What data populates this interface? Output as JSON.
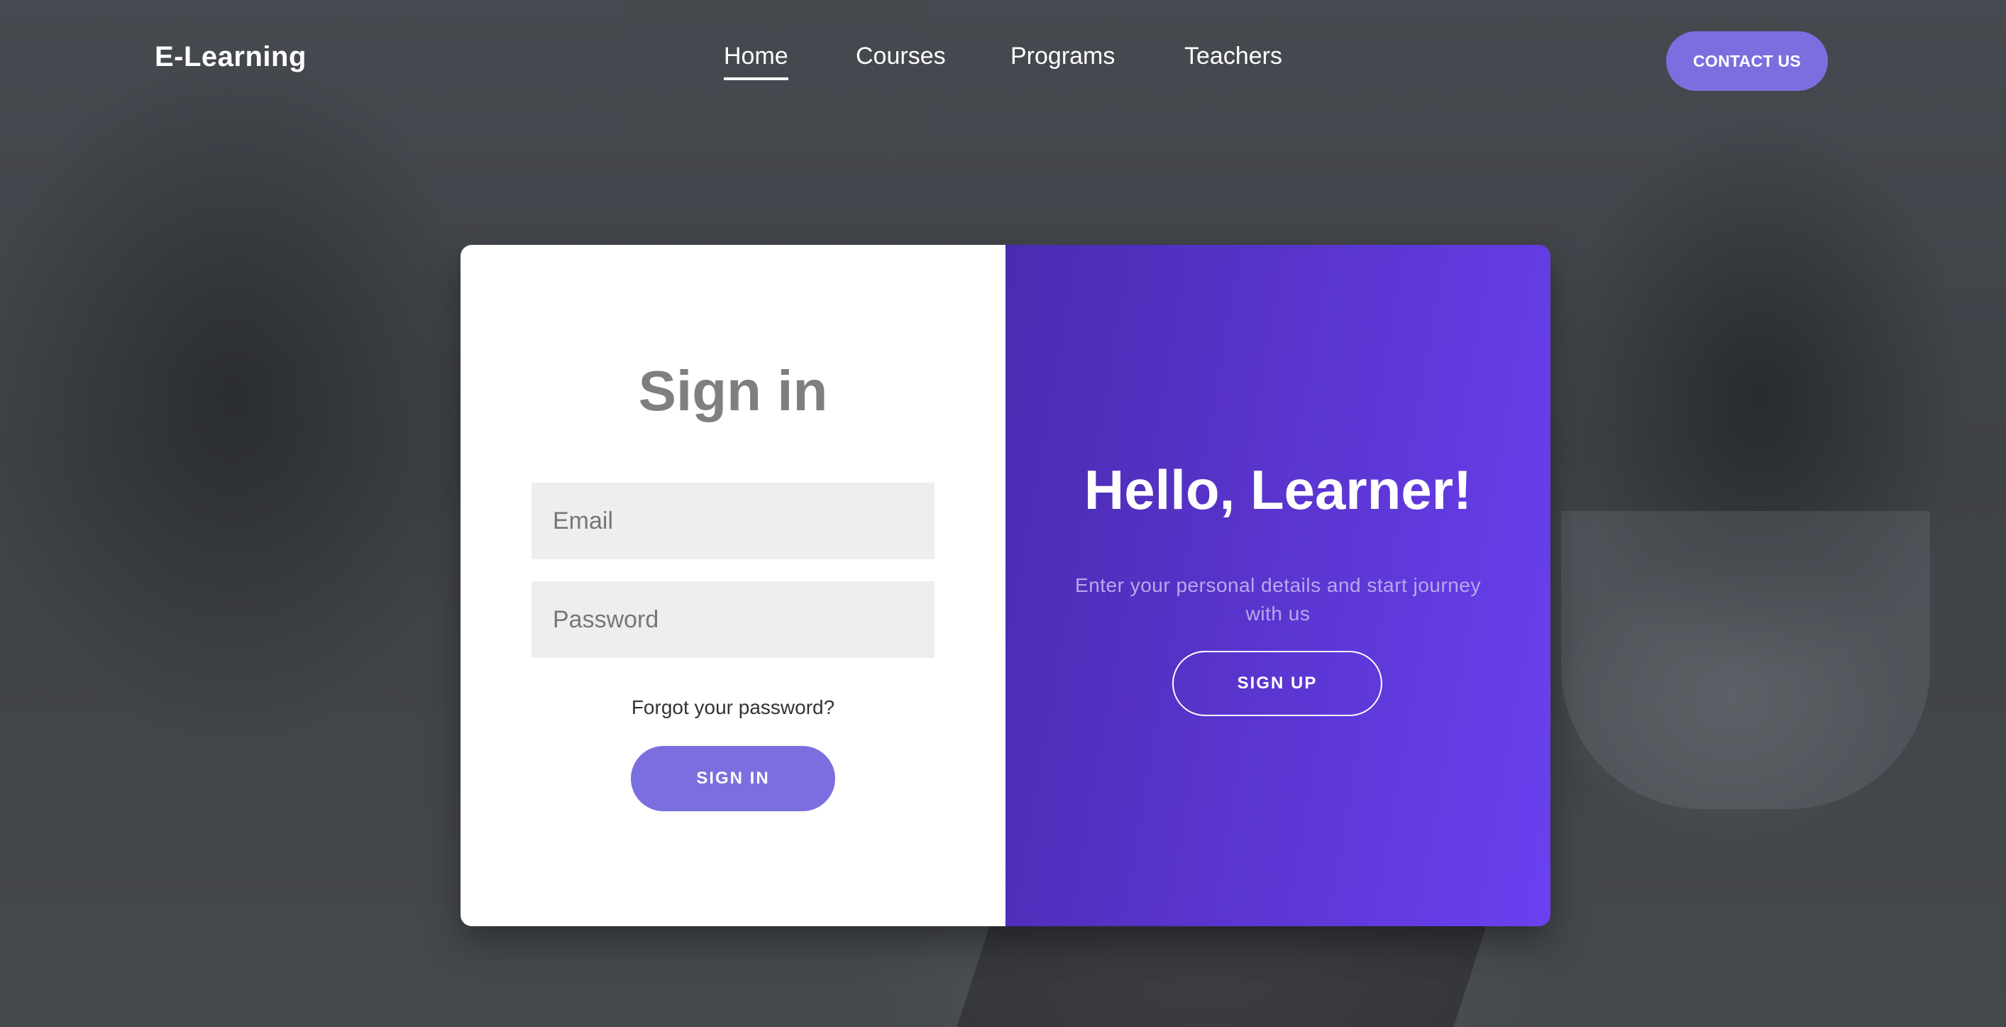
{
  "header": {
    "logo": "E-Learning",
    "nav": [
      {
        "label": "Home",
        "active": true
      },
      {
        "label": "Courses",
        "active": false
      },
      {
        "label": "Programs",
        "active": false
      },
      {
        "label": "Teachers",
        "active": false
      }
    ],
    "contact_label": "CONTACT US"
  },
  "signin": {
    "title": "Sign in",
    "email_placeholder": "Email",
    "password_placeholder": "Password",
    "forgot_label": "Forgot your password?",
    "button_label": "SIGN IN"
  },
  "welcome": {
    "title": "Hello, Learner!",
    "text": "Enter your personal details and start journey with us",
    "button_label": "SIGN UP"
  },
  "colors": {
    "accent": "#7b6fe0",
    "panel_gradient_start": "#4a2bb0",
    "panel_gradient_end": "#6a40f0"
  }
}
